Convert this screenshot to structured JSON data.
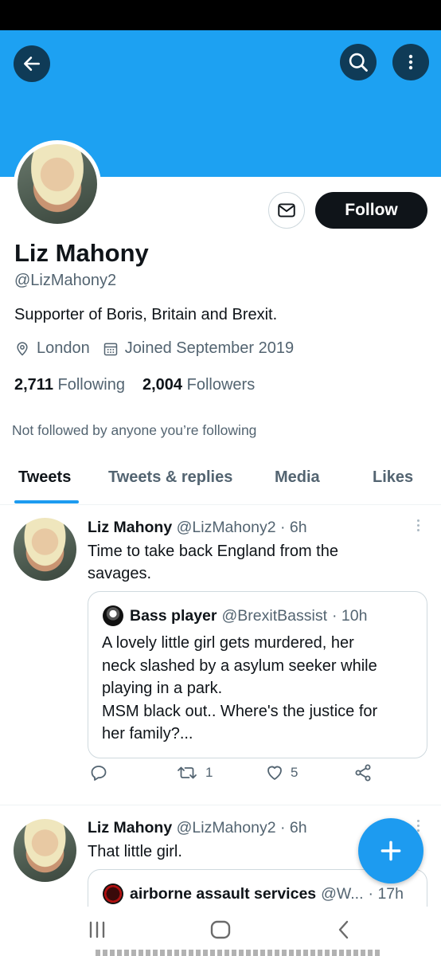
{
  "profile": {
    "name": "Liz Mahony",
    "handle": "@LizMahony2",
    "bio": "Supporter of Boris, Britain and Brexit.",
    "location": "London",
    "joined": "Joined September 2019",
    "following_count": "2,711",
    "following_label": "Following",
    "followers_count": "2,004",
    "followers_label": "Followers",
    "not_followed": "Not followed by anyone you’re following",
    "follow_label": "Follow"
  },
  "tabs": [
    {
      "label": "Tweets"
    },
    {
      "label": "Tweets & replies"
    },
    {
      "label": "Media"
    },
    {
      "label": "Likes"
    }
  ],
  "tweets": [
    {
      "name": "Liz Mahony",
      "handle": "@LizMahony2",
      "time": "· 6h",
      "line1": "Time to take back England from the",
      "line2": "savages.",
      "quote": {
        "name": "Bass player",
        "handle": "@BrexitBassist",
        "time": "· 10h",
        "lines": [
          "A lovely little girl gets murdered, her",
          "neck slashed by a asylum seeker while",
          "playing in a park.",
          "MSM black out.. Where's the justice for",
          "her family?..."
        ]
      },
      "retweets": "1",
      "likes": "5"
    },
    {
      "name": "Liz Mahony",
      "handle": "@LizMahony2",
      "time": "· 6h",
      "text": "That little girl.",
      "quote": {
        "name": "airborne assault services",
        "handle": "@W...",
        "time": "· 17h"
      }
    }
  ],
  "icons": {
    "back": "arrow-left-icon",
    "search": "search-icon",
    "more": "more-vertical-icon",
    "message": "envelope-icon",
    "location": "location-pin-icon",
    "calendar": "calendar-icon",
    "reply": "reply-icon",
    "retweet": "retweet-icon",
    "like": "heart-icon",
    "share": "share-icon",
    "compose": "plus-icon"
  },
  "colors": {
    "banner": "#1da1f2",
    "accent": "#1d9bf0",
    "text": "#0f1419",
    "muted": "#536471"
  }
}
